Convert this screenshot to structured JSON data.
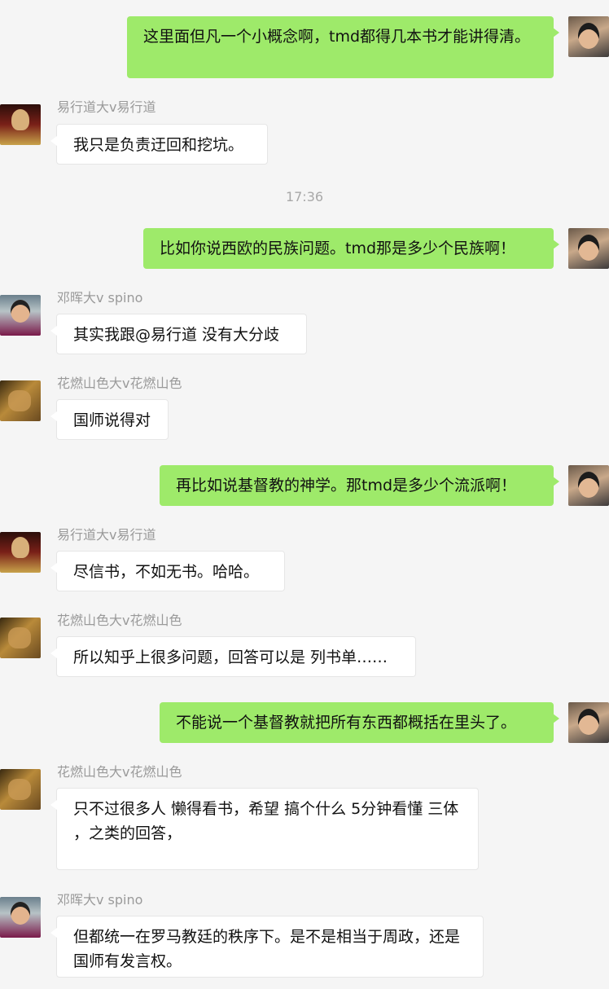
{
  "timestamp": "17:36",
  "messages": [
    {
      "side": "right",
      "text": "这里面但凡一个小概念啊，tmd都得几本书才能讲得清。",
      "avatar": "me"
    },
    {
      "side": "left",
      "name": "易行道大v易行道",
      "text": "我只是负责迂回和挖坑。",
      "avatar": "yi"
    },
    {
      "side": "right",
      "text": "比如你说西欧的民族问题。tmd那是多少个民族啊！",
      "avatar": "me"
    },
    {
      "side": "left",
      "name": "邓晖大v spino",
      "text": "其实我跟@易行道 没有大分歧",
      "avatar": "deng"
    },
    {
      "side": "left",
      "name": "花燃山色大v花燃山色",
      "text": "国师说得对",
      "avatar": "hua"
    },
    {
      "side": "right",
      "text": "再比如说基督教的神学。那tmd是多少个流派啊！",
      "avatar": "me"
    },
    {
      "side": "left",
      "name": "易行道大v易行道",
      "text": "尽信书，不如无书。哈哈。",
      "avatar": "yi"
    },
    {
      "side": "left",
      "name": "花燃山色大v花燃山色",
      "text": "所以知乎上很多问题，回答可以是 列书单……",
      "avatar": "hua"
    },
    {
      "side": "right",
      "text": "不能说一个基督教就把所有东西都概括在里头了。",
      "avatar": "me"
    },
    {
      "side": "left",
      "name": "花燃山色大v花燃山色",
      "text": "只不过很多人 懒得看书，希望 搞个什么 5分钟看懂 三体 ，之类的回答，",
      "avatar": "hua"
    },
    {
      "side": "left",
      "name": "邓晖大v spino",
      "text": "但都统一在罗马教廷的秩序下。是不是相当于周政，还是国师有发言权。",
      "avatar": "deng"
    }
  ]
}
